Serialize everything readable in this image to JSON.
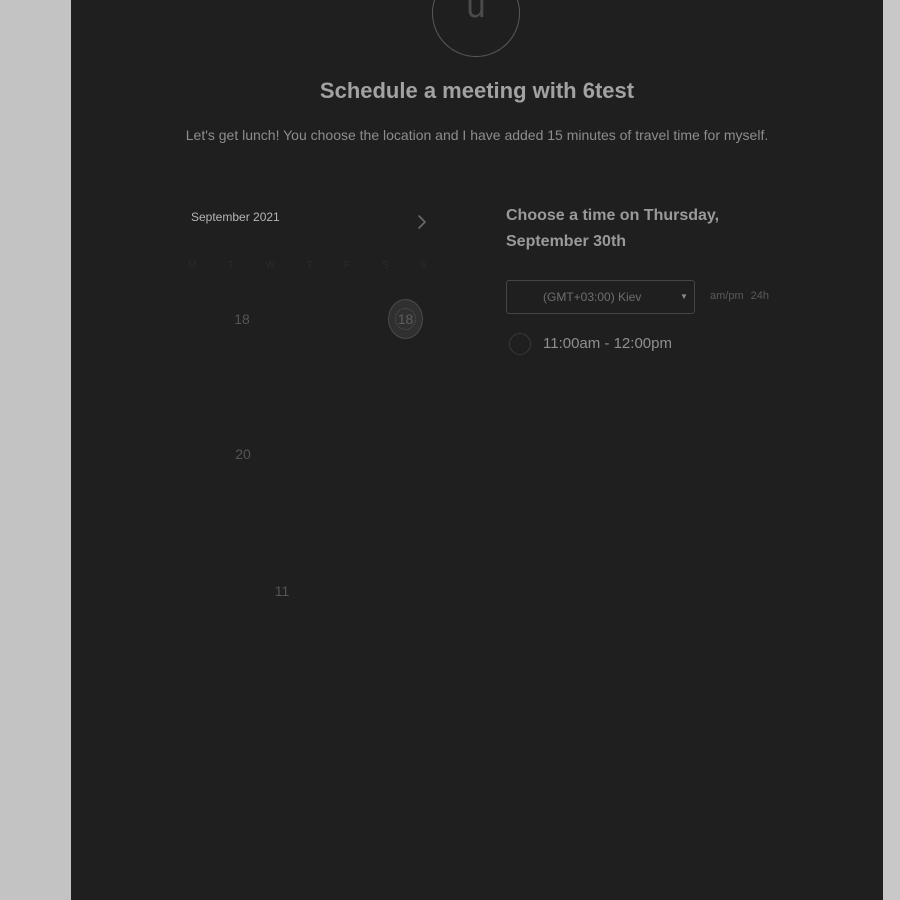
{
  "header": {
    "avatar_letter": "u",
    "title": "Schedule a meeting with 6test",
    "subtitle": "Let's get lunch! You choose the location and I have added 15 minutes of travel time for myself."
  },
  "calendar": {
    "month_label": "September 2021",
    "next_icon": "chevron-right-icon",
    "weekdays": [
      "M",
      "T",
      "W",
      "T",
      "F",
      "S",
      "S"
    ],
    "visible_numbers": {
      "n1": "18",
      "n2": "20",
      "n3": "11"
    },
    "selected_day": "18"
  },
  "times": {
    "heading": "Choose a time on Thursday, September 30th",
    "timezone_value": "(GMT+03:00) Kiev",
    "format_ampm": "am/pm",
    "format_24h": "24h",
    "slots": [
      {
        "label": "11:00am - 12:00pm"
      }
    ]
  },
  "colors": {
    "background_panel": "#1f1f1f",
    "background_outside": "#c3c3c3",
    "text_primary": "#a2a2a2"
  }
}
